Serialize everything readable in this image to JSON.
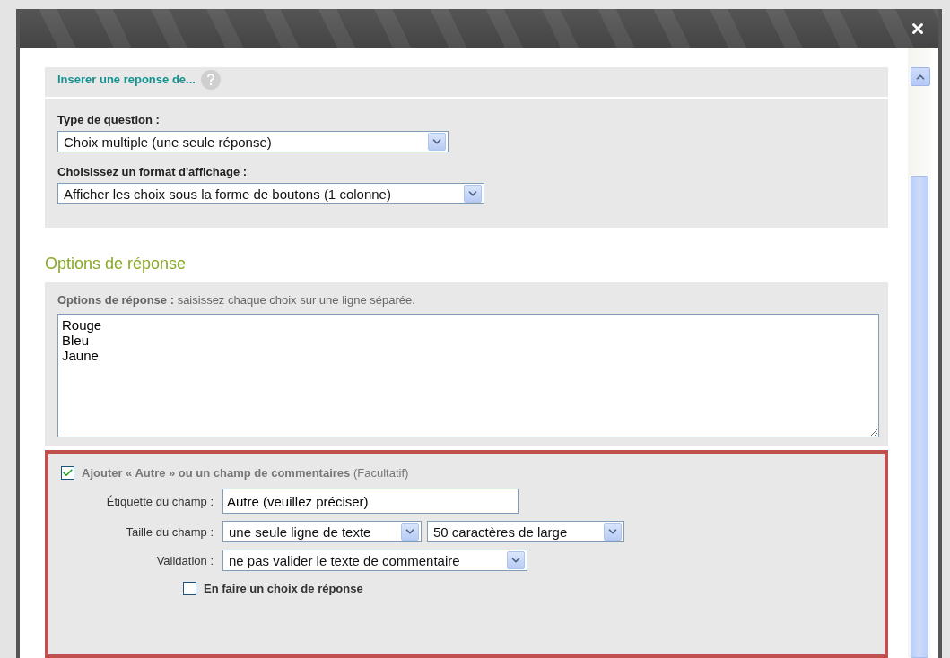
{
  "insert_link": {
    "label": "Inserer une reponse de..."
  },
  "question_type": {
    "label": "Type de question :",
    "value": "Choix multiple (une seule réponse)"
  },
  "display_format": {
    "label": "Choisissez un format d'affichage :",
    "value": "Afficher les choix sous la forme de boutons (1 colonne)"
  },
  "section_title": "Options de réponse",
  "answer_options": {
    "label": "**Options de réponse :** saisissez chaque choix sur une ligne séparée.",
    "value": "Rouge\nBleu\nJaune"
  },
  "other_field": {
    "checked": true,
    "label": "**Ajouter « Autre » ou un champ de commentaires** (Facultatif)",
    "rows": [
      {
        "kind": "text",
        "label": "Étiquette du champ :",
        "value": "Autre (veuillez préciser)"
      },
      {
        "kind": "selects",
        "label": "Taille du champ :",
        "values": [
          "une seule ligne de texte",
          "50 caractères de large"
        ]
      },
      {
        "kind": "select",
        "label": "Validation :",
        "value": "ne pas valider le texte de commentaire"
      }
    ],
    "as_choice": {
      "checked": false,
      "label": "En faire un choix de réponse"
    }
  }
}
